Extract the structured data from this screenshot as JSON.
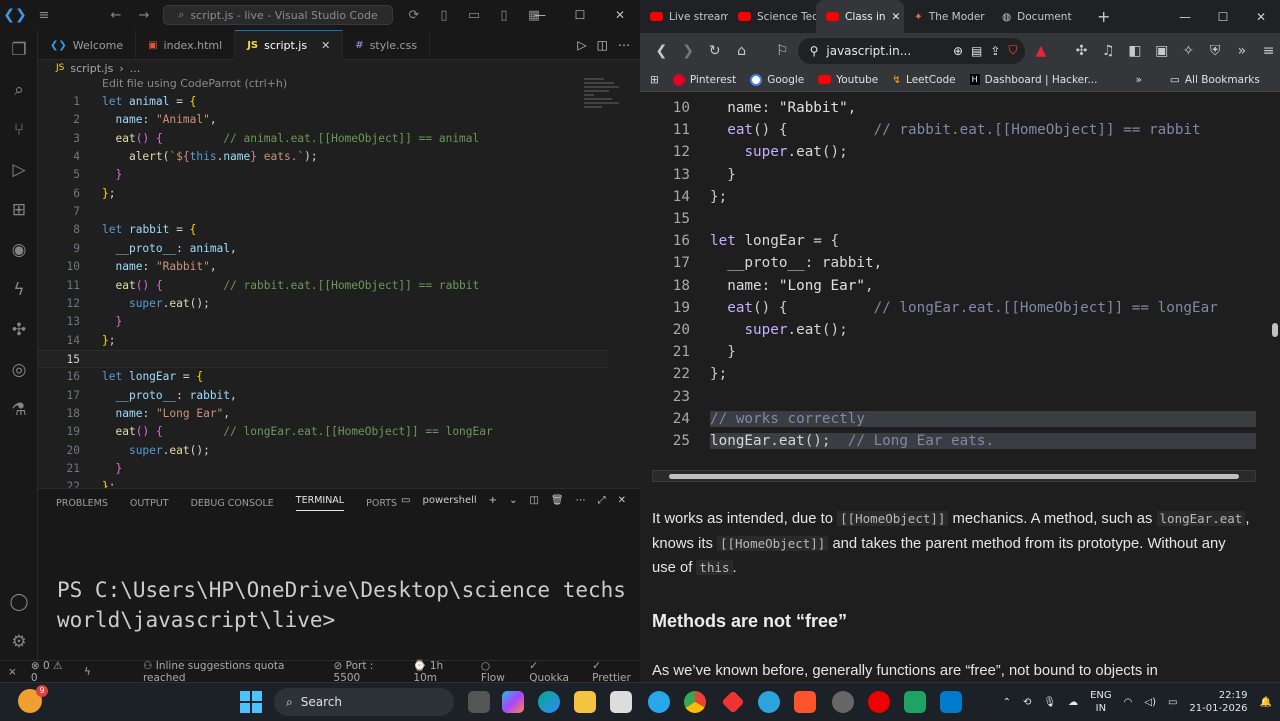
{
  "vscode": {
    "window_title": "script.js - live - Visual Studio Code",
    "tabs": [
      {
        "label": "Welcome",
        "icon": "vscode-logo-icon"
      },
      {
        "label": "index.html",
        "icon": "html-file-icon"
      },
      {
        "label": "script.js",
        "icon": "js-file-icon"
      },
      {
        "label": "style.css",
        "icon": "css-file-icon"
      }
    ],
    "breadcrumb": [
      "script.js",
      "..."
    ],
    "hint": "Edit file using CodeParrot (ctrl+h)",
    "code_lines": [
      {
        "n": "1",
        "html": "<span class=\"kw\">let</span> <span class=\"id\">animal</span> <span class=\"pun\">=</span> <span class=\"br\">{</span>"
      },
      {
        "n": "2",
        "html": "  <span class=\"id\">name</span><span class=\"pun\">:</span> <span class=\"str\">\"Animal\"</span><span class=\"pun\">,</span>"
      },
      {
        "n": "3",
        "html": "  <span class=\"fn\">eat</span><span class=\"br2\">()</span> <span class=\"br2\">{</span>         <span class=\"cm\">// animal.eat.[[HomeObject]] == animal</span>"
      },
      {
        "n": "4",
        "html": "    <span class=\"fn\">alert</span><span class=\"pun\">(</span><span class=\"str\">`${</span><span class=\"this\">this</span><span class=\"pun\">.</span><span class=\"id\">name</span><span class=\"str\">} eats.`</span><span class=\"pun\">);</span>"
      },
      {
        "n": "5",
        "html": "  <span class=\"br2\">}</span>"
      },
      {
        "n": "6",
        "html": "<span class=\"br\">}</span><span class=\"pun\">;</span>"
      },
      {
        "n": "7",
        "html": ""
      },
      {
        "n": "8",
        "html": "<span class=\"kw\">let</span> <span class=\"id\">rabbit</span> <span class=\"pun\">=</span> <span class=\"br\">{</span>"
      },
      {
        "n": "9",
        "html": "  <span class=\"id\">__proto__</span><span class=\"pun\">:</span> <span class=\"id\">animal</span><span class=\"pun\">,</span>"
      },
      {
        "n": "10",
        "html": "  <span class=\"id\">name</span><span class=\"pun\">:</span> <span class=\"str\">\"Rabbit\"</span><span class=\"pun\">,</span>"
      },
      {
        "n": "11",
        "html": "  <span class=\"fn\">eat</span><span class=\"br2\">()</span> <span class=\"br2\">{</span>         <span class=\"cm\">// rabbit.eat.[[HomeObject]] == rabbit</span>"
      },
      {
        "n": "12",
        "html": "    <span class=\"kw\">super</span><span class=\"pun\">.</span><span class=\"fn\">eat</span><span class=\"pun\">();</span>"
      },
      {
        "n": "13",
        "html": "  <span class=\"br2\">}</span>"
      },
      {
        "n": "14",
        "html": "<span class=\"br\">}</span><span class=\"pun\">;</span>"
      },
      {
        "n": "15",
        "html": ""
      },
      {
        "n": "16",
        "html": "<span class=\"kw\">let</span> <span class=\"id\">longEar</span> <span class=\"pun\">=</span> <span class=\"br\">{</span>"
      },
      {
        "n": "17",
        "html": "  <span class=\"id\">__proto__</span><span class=\"pun\">:</span> <span class=\"id\">rabbit</span><span class=\"pun\">,</span>"
      },
      {
        "n": "18",
        "html": "  <span class=\"id\">name</span><span class=\"pun\">:</span> <span class=\"str\">\"Long Ear\"</span><span class=\"pun\">,</span>"
      },
      {
        "n": "19",
        "html": "  <span class=\"fn\">eat</span><span class=\"br2\">()</span> <span class=\"br2\">{</span>         <span class=\"cm\">// longEar.eat.[[HomeObject]] == longEar</span>"
      },
      {
        "n": "20",
        "html": "    <span class=\"kw\">super</span><span class=\"pun\">.</span><span class=\"fn\">eat</span><span class=\"pun\">();</span>"
      },
      {
        "n": "21",
        "html": "  <span class=\"br2\">}</span>"
      },
      {
        "n": "22",
        "html": "<span class=\"br\">}</span><span class=\"pun\">;</span>"
      }
    ],
    "panel_tabs": [
      "PROBLEMS",
      "OUTPUT",
      "DEBUG CONSOLE",
      "TERMINAL",
      "PORTS"
    ],
    "terminal_shell": "powershell",
    "terminal_text": "PS C:\\Users\\HP\\OneDrive\\Desktop\\science techsworld\\javascript\\live>",
    "status": {
      "errors": "0",
      "warnings": "0",
      "suggestions": "Inline suggestions quota reached",
      "port": "Port : 5500",
      "time": "1h 10m",
      "flow": "Flow",
      "quokka": "Quokka",
      "prettier": "Prettier"
    }
  },
  "browser": {
    "tabs": [
      {
        "label": "Live stream",
        "icon": "youtube-icon"
      },
      {
        "label": "Science Tec",
        "icon": "youtube-icon"
      },
      {
        "label": "Class in",
        "icon": "youtube-icon"
      },
      {
        "label": "The Moder",
        "icon": "page-icon"
      },
      {
        "label": "Document",
        "icon": "globe-icon"
      }
    ],
    "url": "javascript.in...",
    "bookmarks": [
      "Pinterest",
      "Google",
      "Youtube",
      "LeetCode",
      "Dashboard | Hacker..."
    ],
    "all_bookmarks": "All Bookmarks",
    "code_lines": [
      {
        "n": "10",
        "html": "  <span class=\"bid\">name</span>: <span class=\"bstr\">\"Rabbit\"</span>,"
      },
      {
        "n": "11",
        "html": "  <span class=\"bkw\">eat</span>() {          <span class=\"bcm\">// rabbit.eat.[[HomeObject]] == rabbit</span>"
      },
      {
        "n": "12",
        "html": "    <span class=\"bkw\">super</span>.<span class=\"bid\">eat</span>();"
      },
      {
        "n": "13",
        "html": "  }"
      },
      {
        "n": "14",
        "html": "};"
      },
      {
        "n": "15",
        "html": ""
      },
      {
        "n": "16",
        "html": "<span class=\"bkw\">let</span> <span class=\"bid\">longEar</span> = {"
      },
      {
        "n": "17",
        "html": "  <span class=\"bid\">__proto__</span>: <span class=\"bid\">rabbit</span>,"
      },
      {
        "n": "18",
        "html": "  <span class=\"bid\">name</span>: <span class=\"bstr\">\"Long Ear\"</span>,"
      },
      {
        "n": "19",
        "html": "  <span class=\"bkw\">eat</span>() {          <span class=\"bcm\">// longEar.eat.[[HomeObject]] == longEar</span>"
      },
      {
        "n": "20",
        "html": "    <span class=\"bkw\">super</span>.<span class=\"bid\">eat</span>();"
      },
      {
        "n": "21",
        "html": "  }"
      },
      {
        "n": "22",
        "html": "};"
      },
      {
        "n": "23",
        "html": ""
      },
      {
        "n": "24",
        "html": "<span class=\"hl\"><span class=\"bcm\">// works correctly</span>                                                    </span>"
      },
      {
        "n": "25",
        "html": "<span class=\"hl\"><span class=\"bid\">longEar</span>.<span class=\"bid\">eat</span>();  <span class=\"bcm\">// Long Ear eats.</span>                                    </span>"
      }
    ],
    "para1": "It works as intended, due to <span class=\"code-inline\">[[HomeObject]]</span> mechanics. A method, such as <span class=\"code-inline\">longEar.eat</span>, knows its <span class=\"code-inline\">[[HomeObject]]</span> and takes the parent method from its prototype. Without any use of <span class=\"code-inline\">this</span>.",
    "heading": "Methods are not “free”",
    "para2": "As we’ve known before, generally functions are “free”, not bound to objects in"
  },
  "taskbar": {
    "search": "Search",
    "lang": "ENG",
    "region": "IN",
    "time": "22:19",
    "date": "21-01-2026",
    "notification_count": "9"
  }
}
